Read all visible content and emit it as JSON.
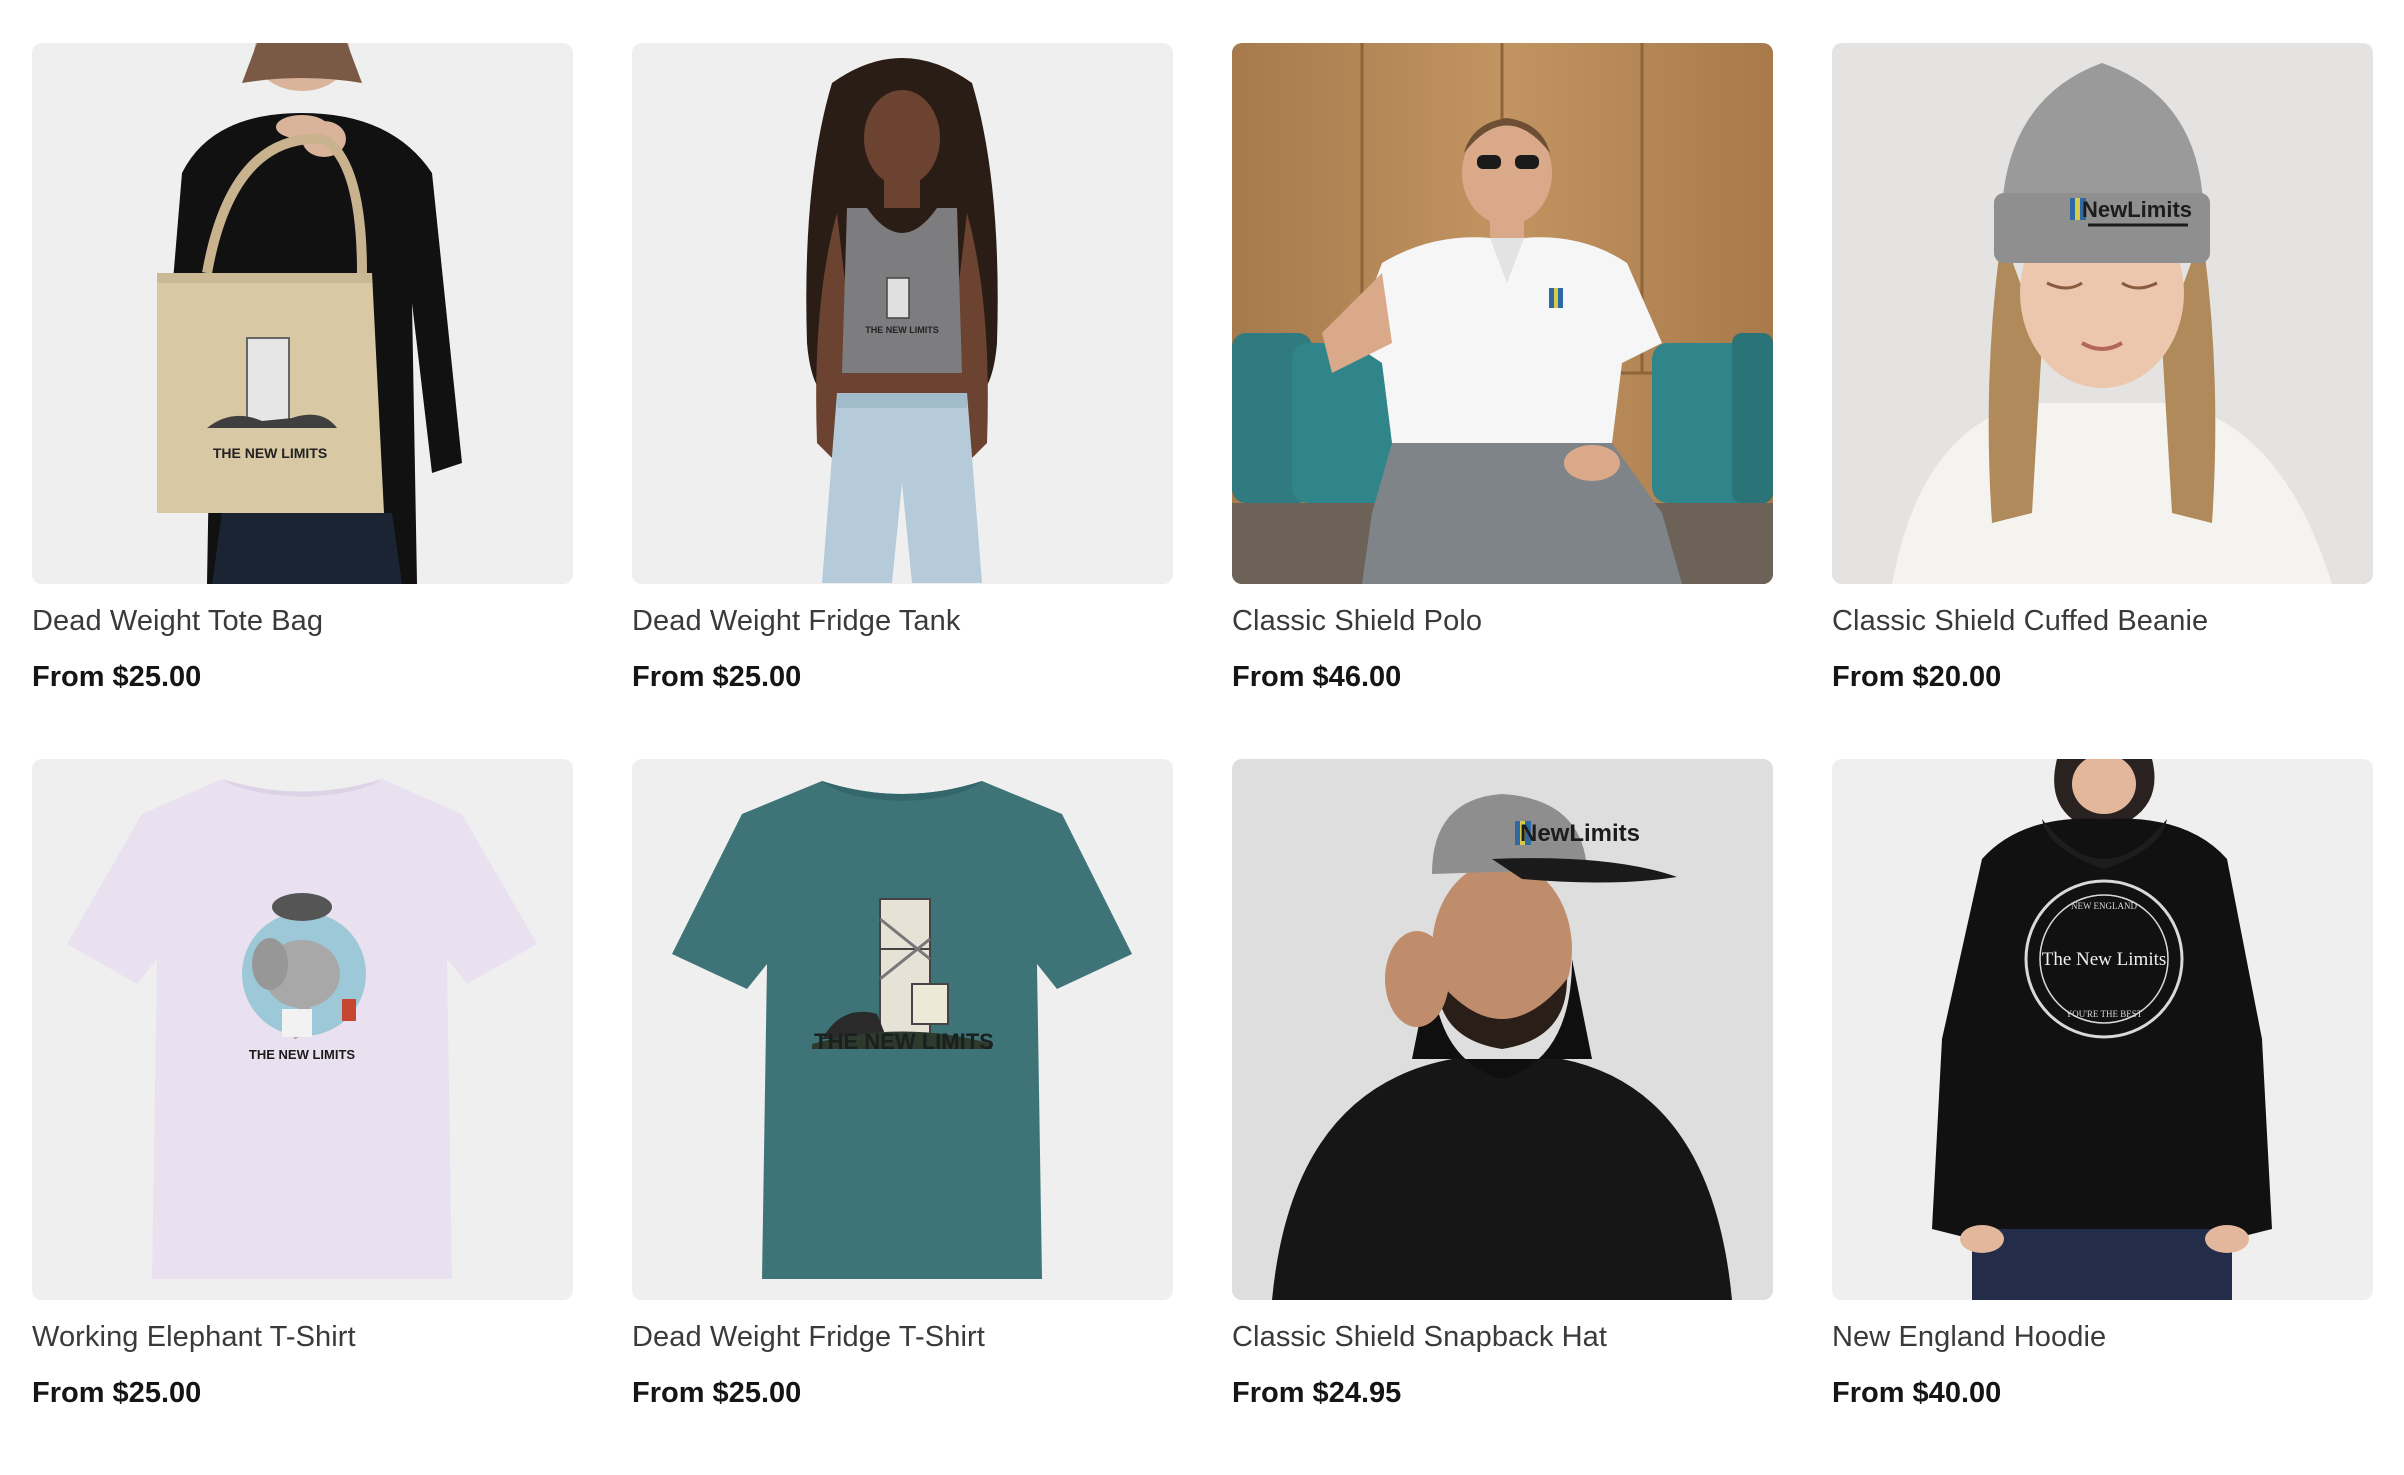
{
  "products": [
    {
      "title": "Dead Weight Tote Bag",
      "price": "From $25.00",
      "image": "tote-bag-photo"
    },
    {
      "title": "Dead Weight Fridge Tank",
      "price": "From $25.00",
      "image": "tank-top-photo"
    },
    {
      "title": "Classic Shield Polo",
      "price": "From $46.00",
      "image": "polo-photo"
    },
    {
      "title": "Classic Shield Cuffed Beanie",
      "price": "From $20.00",
      "image": "beanie-photo"
    },
    {
      "title": "Working Elephant T-Shirt",
      "price": "From $25.00",
      "image": "elephant-tshirt-photo"
    },
    {
      "title": "Dead Weight Fridge T-Shirt",
      "price": "From $25.00",
      "image": "fridge-tshirt-photo"
    },
    {
      "title": "Classic Shield Snapback Hat",
      "price": "From $24.95",
      "image": "snapback-photo"
    },
    {
      "title": "New England Hoodie",
      "price": "From $40.00",
      "image": "hoodie-photo"
    }
  ],
  "image_text": {
    "tote_print": "THE NEW LIMITS",
    "tank_print": "THE NEW LIMITS",
    "beanie_logo": "NewLimits",
    "elephant_print": "THE NEW LIMITS",
    "fridge_print": "THE NEW LIMITS",
    "snapback_logo": "NewLimits",
    "hoodie_main": "The New Limits",
    "hoodie_ring_top": "NEW ENGLAND",
    "hoodie_ring_bottom": "YOU'RE THE BEST"
  }
}
